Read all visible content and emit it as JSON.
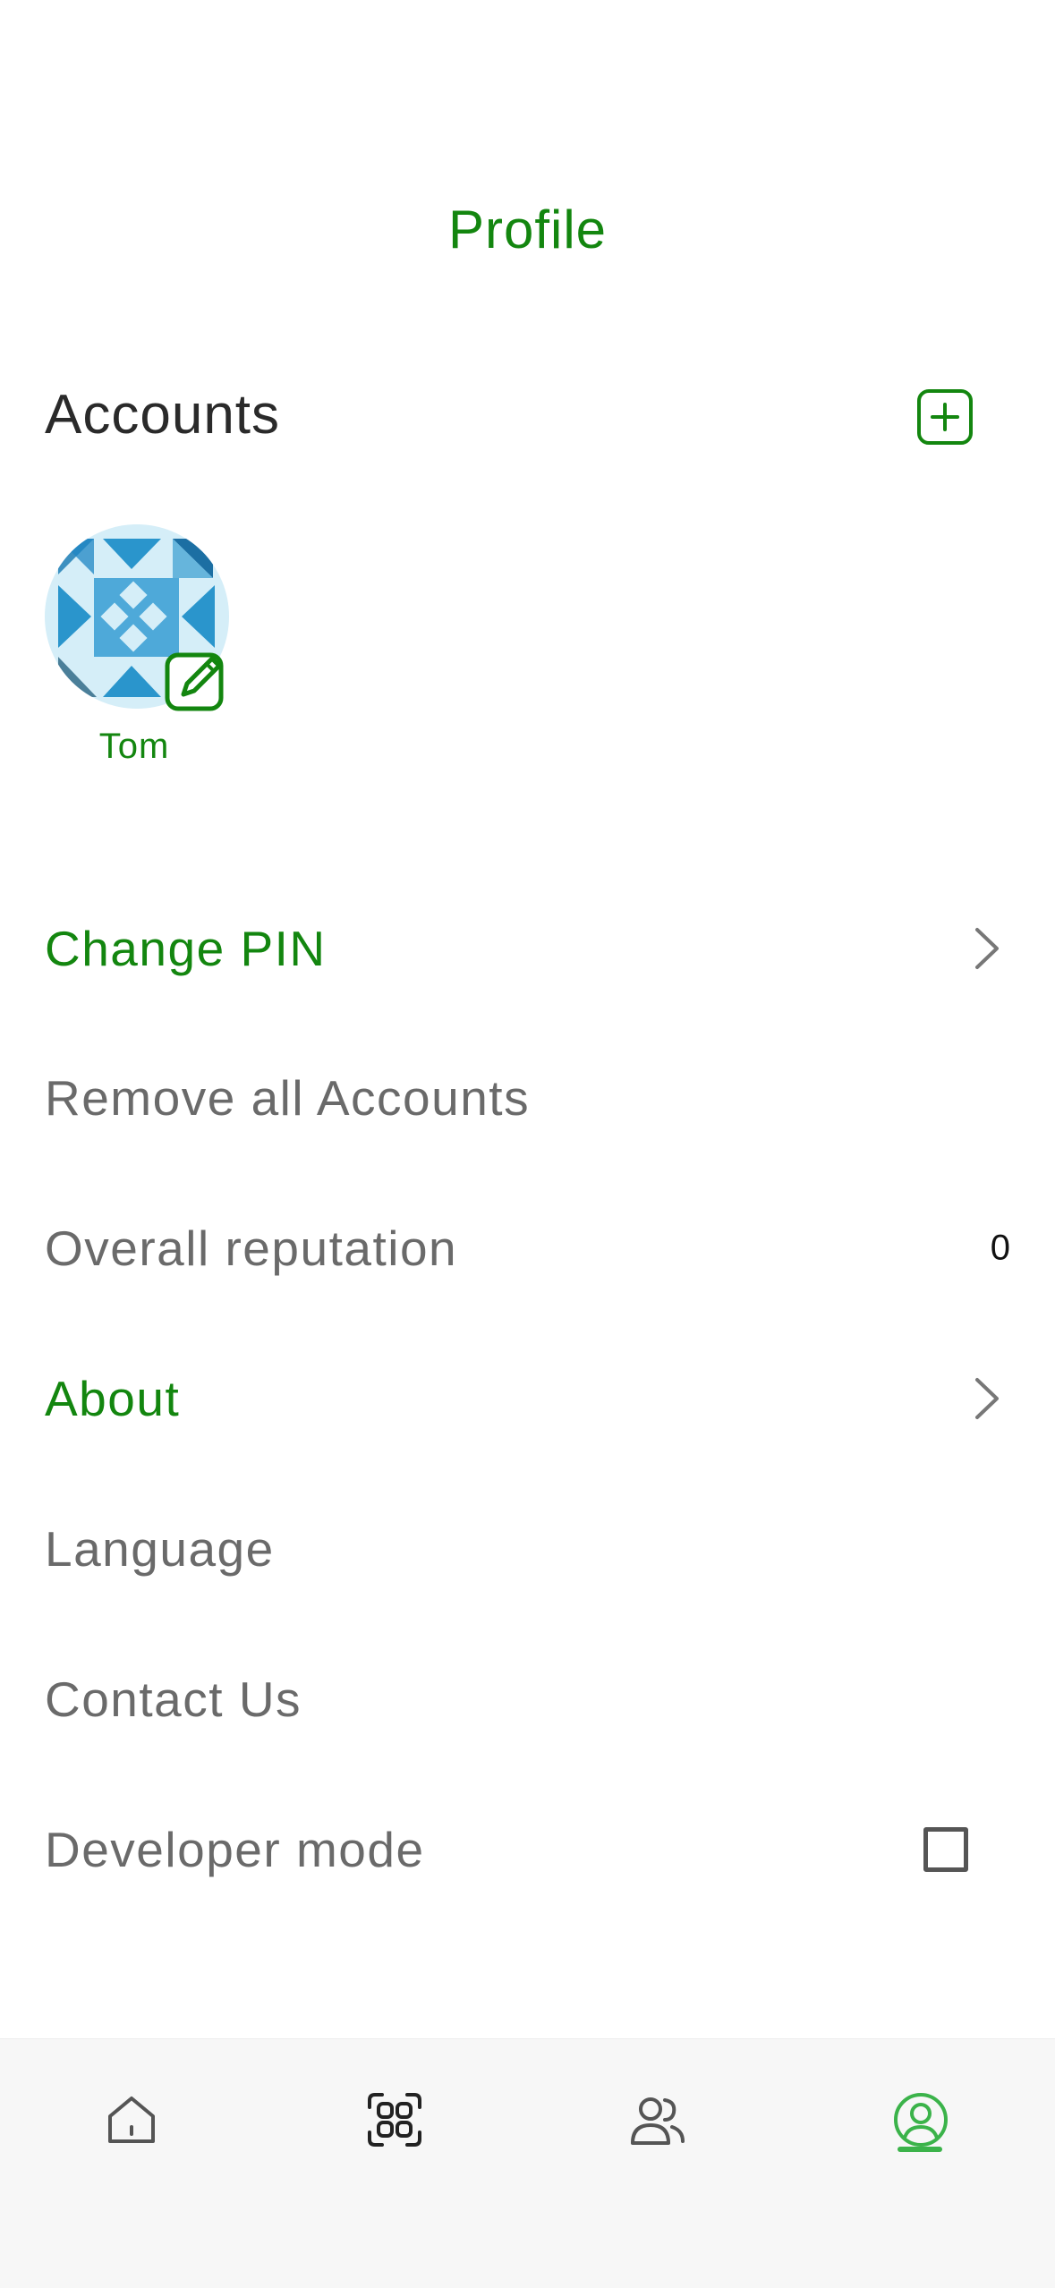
{
  "header": {
    "title": "Profile"
  },
  "accounts": {
    "heading": "Accounts",
    "add_icon": "plus-square-icon",
    "items": [
      {
        "name": "Tom",
        "avatar": "identicon-avatar",
        "edit_icon": "edit-pencil-icon"
      }
    ]
  },
  "menu": {
    "change_pin": {
      "label": "Change PIN",
      "icon": "chevron-right-icon"
    },
    "remove_accounts": {
      "label": "Remove all Accounts"
    },
    "reputation": {
      "label": "Overall reputation",
      "value": "0"
    },
    "about": {
      "label": "About",
      "icon": "chevron-right-icon"
    },
    "language": {
      "label": "Language"
    },
    "contact": {
      "label": "Contact Us"
    },
    "developer_mode": {
      "label": "Developer mode",
      "checked": false
    }
  },
  "bottom_nav": {
    "items": [
      {
        "icon": "home-icon",
        "active": false
      },
      {
        "icon": "scan-icon",
        "active": false
      },
      {
        "icon": "contacts-icon",
        "active": false
      },
      {
        "icon": "profile-icon",
        "active": true
      }
    ]
  },
  "colors": {
    "accent": "#13860f",
    "active_nav": "#3bb34a",
    "text_primary": "#2a2a2a",
    "text_secondary": "#6a6a6a",
    "nav_background": "#f7f7f7"
  }
}
